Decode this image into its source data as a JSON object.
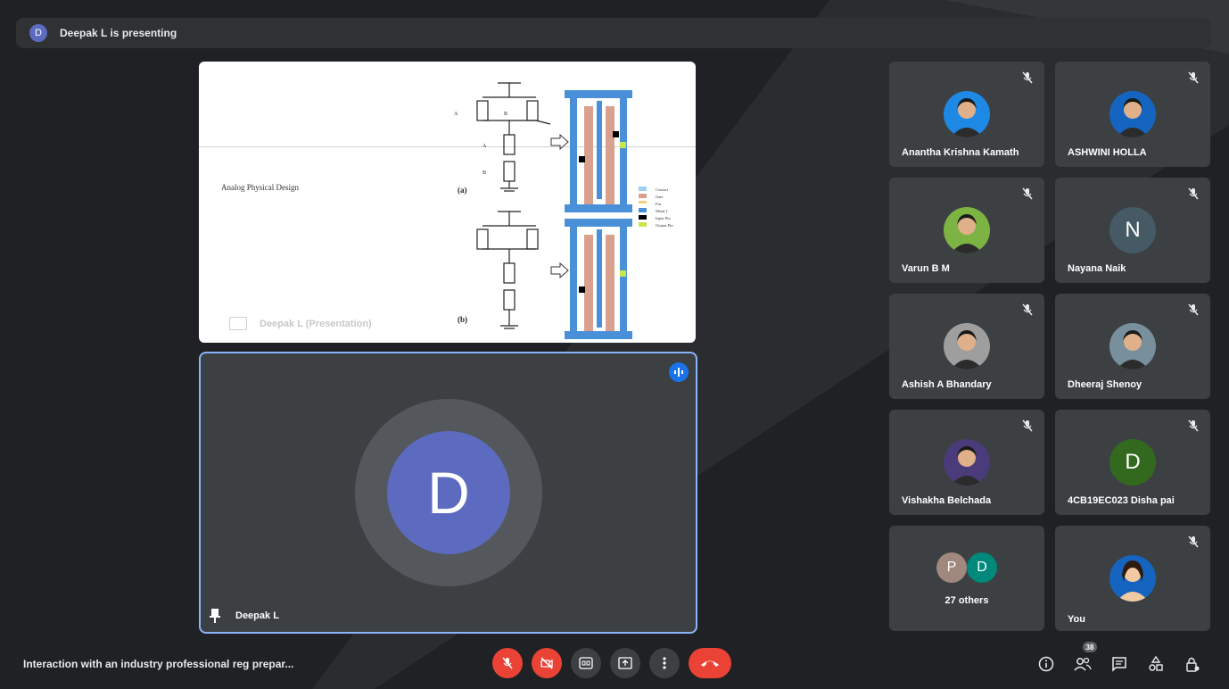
{
  "presenting_banner": {
    "avatar_letter": "D",
    "text": "Deepak L is presenting"
  },
  "slide": {
    "title": "Analog Physical Design",
    "label_a": "(a)",
    "label_b": "(b)",
    "watermark": "Deepak L (Presentation)",
    "legend": [
      "Contact",
      "Gate",
      "Fin",
      "Metal 1",
      "Input Pin",
      "Output Pin"
    ]
  },
  "main_speaker": {
    "avatar_letter": "D",
    "name": "Deepak L",
    "avatar_color": "#5c6bc0"
  },
  "participants": [
    {
      "name": "Anantha Krishna Kamath",
      "avatar": "photo",
      "color": "#1e88e5"
    },
    {
      "name": "ASHWINI HOLLA",
      "avatar": "photo",
      "color": "#1565c0"
    },
    {
      "name": "Varun B M",
      "avatar": "photo",
      "color": "#7cb342"
    },
    {
      "name": "Nayana Naik",
      "avatar_letter": "N",
      "color": "#455a64"
    },
    {
      "name": "Ashish A Bhandary",
      "avatar": "photo",
      "color": "#9e9e9e"
    },
    {
      "name": "Dheeraj Shenoy",
      "avatar": "photo",
      "color": "#78909c"
    },
    {
      "name": "Vishakha Belchada",
      "avatar": "photo",
      "color": "#4a3b7a"
    },
    {
      "name": "4CB19EC023 Disha pai",
      "avatar_letter": "D",
      "color": "#33691e"
    }
  ],
  "others_tile": {
    "avatars": [
      "P",
      "D"
    ],
    "colors": [
      "#a1887f",
      "#00897b"
    ],
    "label": "27 others"
  },
  "self_tile": {
    "name": "You",
    "avatar": "photo",
    "color": "#1565c0"
  },
  "bottom_bar": {
    "meeting_title": "Interaction with an industry professional reg prepar...",
    "participants_count": "38"
  },
  "colors": {
    "background": "#202124",
    "tile": "#3c4043",
    "accent": "#8ab4f8",
    "end_call": "#ea4335"
  }
}
